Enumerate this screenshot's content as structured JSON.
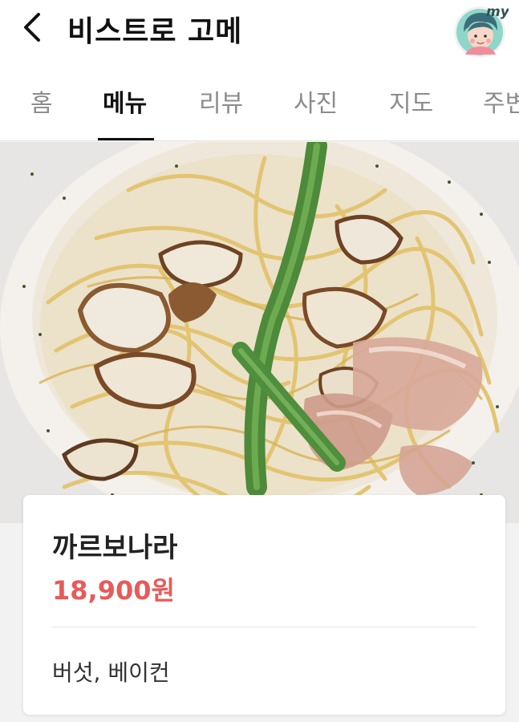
{
  "header": {
    "title": "비스트로 고메",
    "back_icon": "chevron-left-icon",
    "avatar_badge": "my"
  },
  "tabs": [
    {
      "label": "홈",
      "active": false
    },
    {
      "label": "메뉴",
      "active": true
    },
    {
      "label": "리뷰",
      "active": false
    },
    {
      "label": "사진",
      "active": false
    },
    {
      "label": "지도",
      "active": false
    },
    {
      "label": "주변",
      "active": false
    }
  ],
  "menu": {
    "name": "까르보나라",
    "price": "18,900원",
    "description": "버섯, 베이컨"
  },
  "colors": {
    "price": "#e85a5a",
    "avatar_bg": "#8fd6c9",
    "active_tab": "#111111",
    "inactive_tab": "#8c8c8c"
  }
}
